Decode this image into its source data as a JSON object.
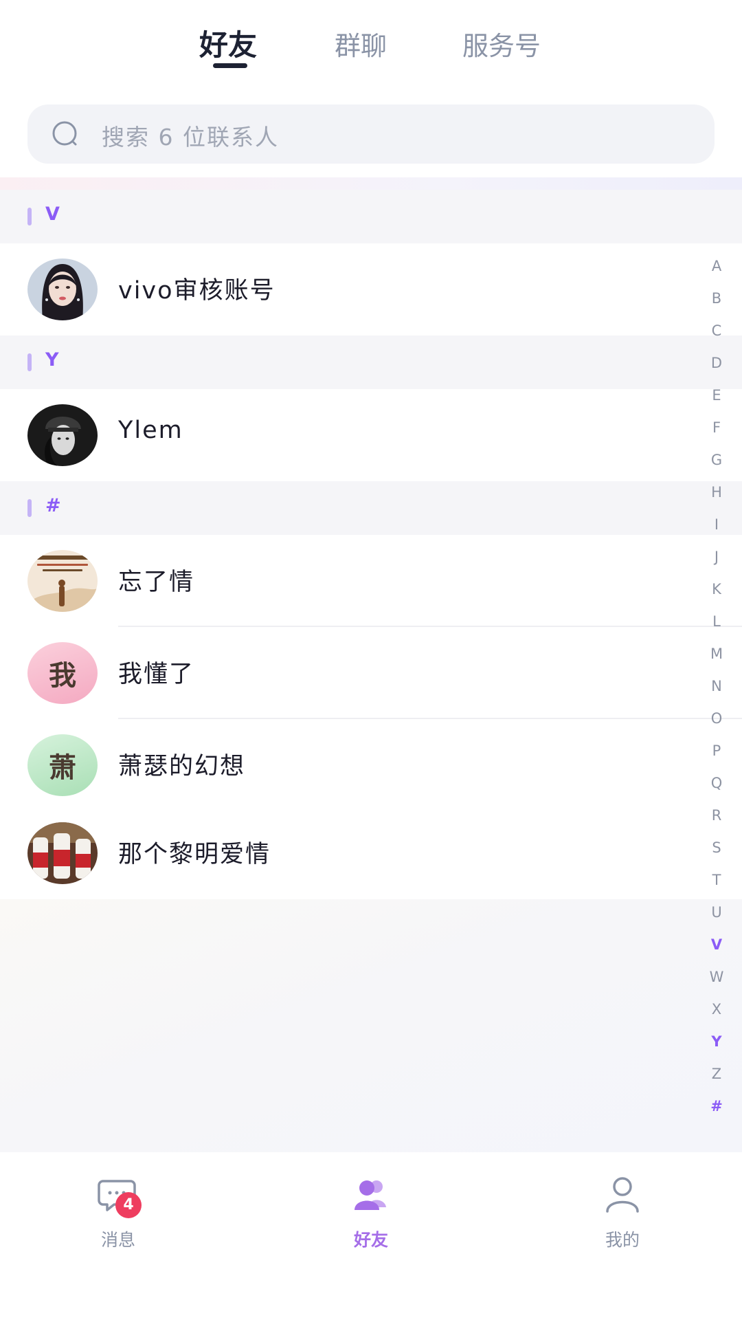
{
  "tabs": [
    {
      "label": "好友",
      "active": true
    },
    {
      "label": "群聊",
      "active": false
    },
    {
      "label": "服务号",
      "active": false
    }
  ],
  "search": {
    "placeholder": "搜索 6 位联系人"
  },
  "sections": [
    {
      "letter": "V",
      "contacts": [
        {
          "name": "vivo审核账号",
          "avatar": "photo-woman"
        }
      ]
    },
    {
      "letter": "Y",
      "contacts": [
        {
          "name": "Ylem",
          "avatar": "photo-bw-portrait"
        }
      ]
    },
    {
      "letter": "#",
      "contacts": [
        {
          "name": "忘了情",
          "avatar": "photo-calligraphy"
        },
        {
          "name": "我懂了",
          "avatar_text": "我",
          "avatar_color": "#f7b8cb"
        },
        {
          "name": "萧瑟的幻想",
          "avatar_text": "萧",
          "avatar_color": "#bfe8c8"
        },
        {
          "name": "那个黎明爱情",
          "avatar": "photo-bottles"
        }
      ]
    }
  ],
  "index_letters": [
    "A",
    "B",
    "C",
    "D",
    "E",
    "F",
    "G",
    "H",
    "I",
    "J",
    "K",
    "L",
    "M",
    "N",
    "O",
    "P",
    "Q",
    "R",
    "S",
    "T",
    "U",
    "V",
    "W",
    "X",
    "Y",
    "Z",
    "#"
  ],
  "index_highlighted": [
    "V",
    "Y",
    "#"
  ],
  "bottom_nav": [
    {
      "label": "消息",
      "icon": "chat-icon",
      "badge": "4",
      "active": false
    },
    {
      "label": "好友",
      "icon": "friends-icon",
      "active": true
    },
    {
      "label": "我的",
      "icon": "person-icon",
      "active": false
    }
  ],
  "colors": {
    "accent": "#8b5cf6",
    "badge": "#ee3d5f",
    "nav_active": "#a56ee8"
  }
}
